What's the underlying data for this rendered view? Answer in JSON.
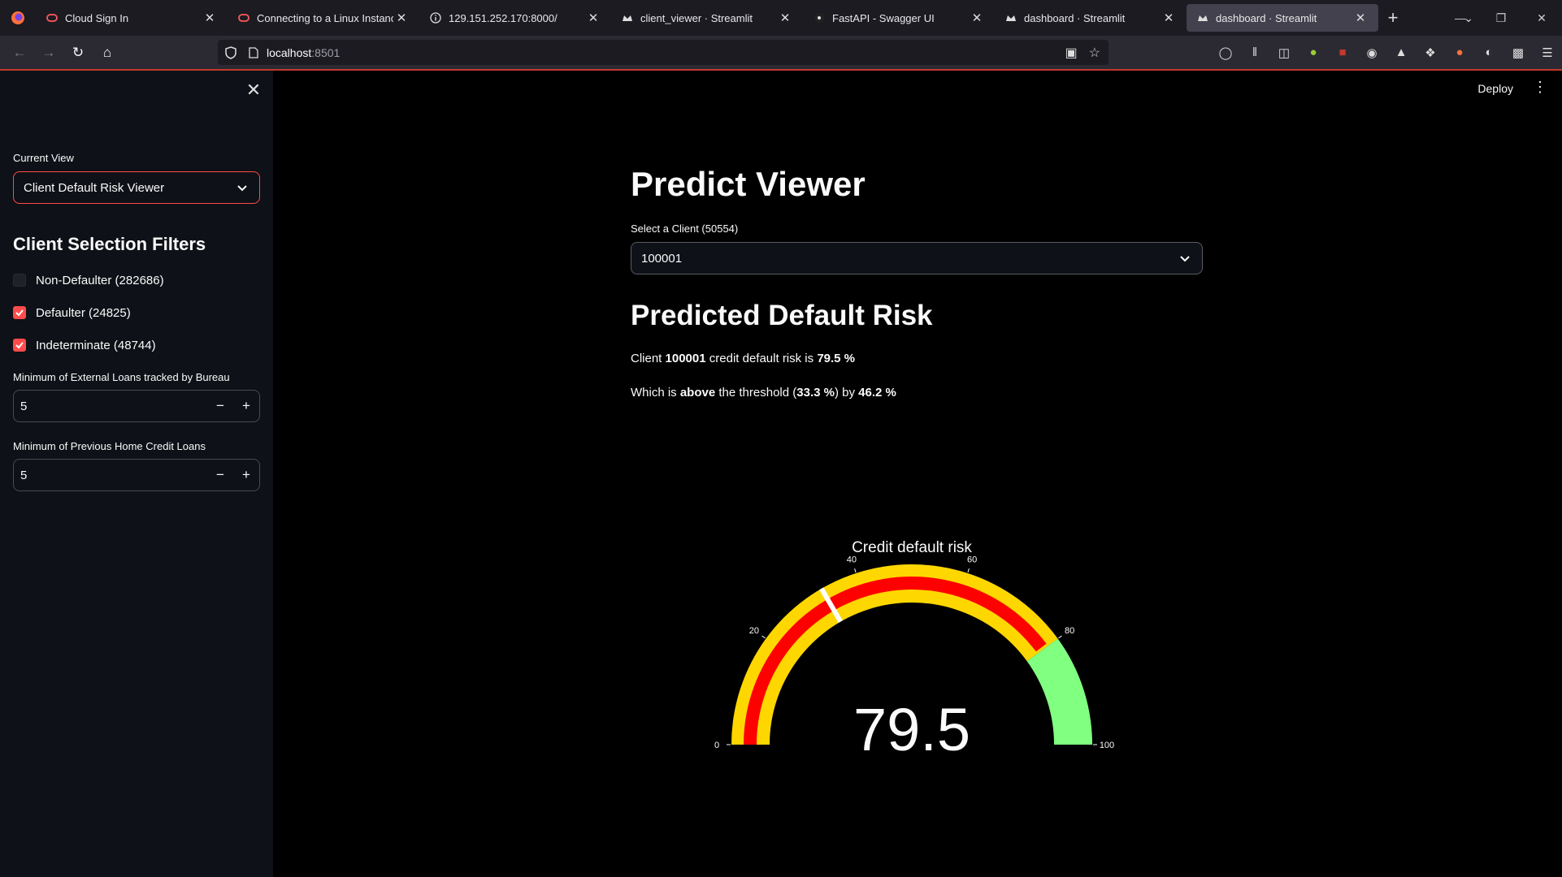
{
  "browser": {
    "tabs": [
      {
        "title": "Cloud Sign In",
        "icon": "oracle-ring-icon",
        "active": false
      },
      {
        "title": "Connecting to a Linux Instance",
        "icon": "oracle-ring-icon",
        "active": false
      },
      {
        "title": "129.151.252.170:8000/",
        "icon": "info-icon",
        "active": false
      },
      {
        "title": "client_viewer · Streamlit",
        "icon": "streamlit-crown-icon",
        "active": false
      },
      {
        "title": "FastAPI - Swagger UI",
        "icon": "swagger-icon",
        "active": false
      },
      {
        "title": "dashboard · Streamlit",
        "icon": "streamlit-crown-icon",
        "active": false
      },
      {
        "title": "dashboard · Streamlit",
        "icon": "streamlit-crown-icon",
        "active": true
      }
    ],
    "url_host": "localhost",
    "url_port": ":8501"
  },
  "sidebar": {
    "view_label": "Current View",
    "view_value": "Client Default Risk Viewer",
    "filters_title": "Client Selection Filters",
    "checkboxes": [
      {
        "label": "Non-Defaulter (282686)",
        "checked": false
      },
      {
        "label": "Defaulter (24825)",
        "checked": true
      },
      {
        "label": "Indeterminate (48744)",
        "checked": true
      }
    ],
    "bureau_label": "Minimum of External Loans tracked by Bureau",
    "bureau_value": "5",
    "prev_label": "Minimum of Previous Home Credit Loans",
    "prev_value": "5"
  },
  "header": {
    "deploy_label": "Deploy"
  },
  "main": {
    "title": "Predict Viewer",
    "client_label": "Select a Client (50554)",
    "client_value": "100001",
    "risk_title": "Predicted Default Risk",
    "line1": {
      "pre": "Client ",
      "client": "100001",
      "mid": " credit default risk is ",
      "risk": "79.5 %"
    },
    "line2": {
      "pre": "Which is ",
      "dir": "above",
      "mid": " the threshold (",
      "threshold": "33.3 %",
      "mid2": ") by ",
      "diff": "46.2 %"
    }
  },
  "chart_data": {
    "type": "gauge",
    "title": "Credit default risk",
    "value": 79.5,
    "value_label": "79.5",
    "range": [
      0,
      100
    ],
    "ticks": [
      "0",
      "20",
      "40",
      "60",
      "80",
      "100"
    ],
    "steps": [
      {
        "range": [
          0,
          80
        ],
        "color": "#ffd700"
      },
      {
        "range": [
          80,
          100
        ],
        "color": "#80ff80"
      }
    ],
    "bar_color": "#ff0000",
    "threshold": {
      "value": 33.3,
      "color": "#ffffff"
    }
  },
  "colors": {
    "accent": "#ff4b4b",
    "sidebar_bg": "#0e1117",
    "main_bg": "#000000"
  }
}
